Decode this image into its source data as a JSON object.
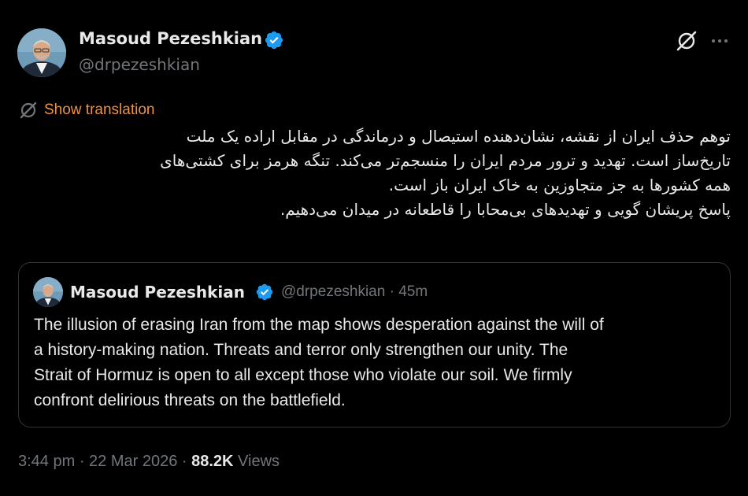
{
  "author": {
    "name": "Masoud Pezeshkian",
    "handle": "@drpezeshkian"
  },
  "icons": {
    "verified": "verified-badge-icon",
    "grok": "grok-icon",
    "more": "more-options-icon",
    "translate": "translate-icon"
  },
  "translate": {
    "label": "Show translation"
  },
  "post": {
    "lines": [
      "توهم حذف ایران از نقشه، نشان‌دهنده استیصال و درماندگی در مقابل اراده یک ملت",
      "تاریخ‌ساز است. تهدید و ترور مردم ایران را منسجم‌تر می‌کند. تنگه هرمز برای کشتی‌های",
      "همه کشورها به جز متجاوزین به خاک ایران باز است.",
      "پاسخ پریشان گویی و تهدیدهای بی‌محابا را قاطعانه در میدان می‌دهیم."
    ]
  },
  "quote": {
    "name": "Masoud Pezeshkian",
    "handle_time": "@drpezeshkian · 45m",
    "lines": [
      "The illusion of erasing Iran from the map shows desperation against the will of",
      "a history-making nation. Threats and terror only strengthen our unity. The",
      "Strait of Hormuz is open to all except those who violate our soil. We firmly",
      "confront delirious threats on the battlefield."
    ]
  },
  "meta": {
    "timestamp": "3:44 pm · 22 Mar 2026 · ",
    "views_count": "88.2K",
    "views_label": " Views"
  },
  "colors": {
    "background": "#000000",
    "text": "#e7e9ea",
    "muted": "#71767b",
    "verified": "#1d9bf0",
    "translate": "#f0913e",
    "border": "#2f3336"
  }
}
